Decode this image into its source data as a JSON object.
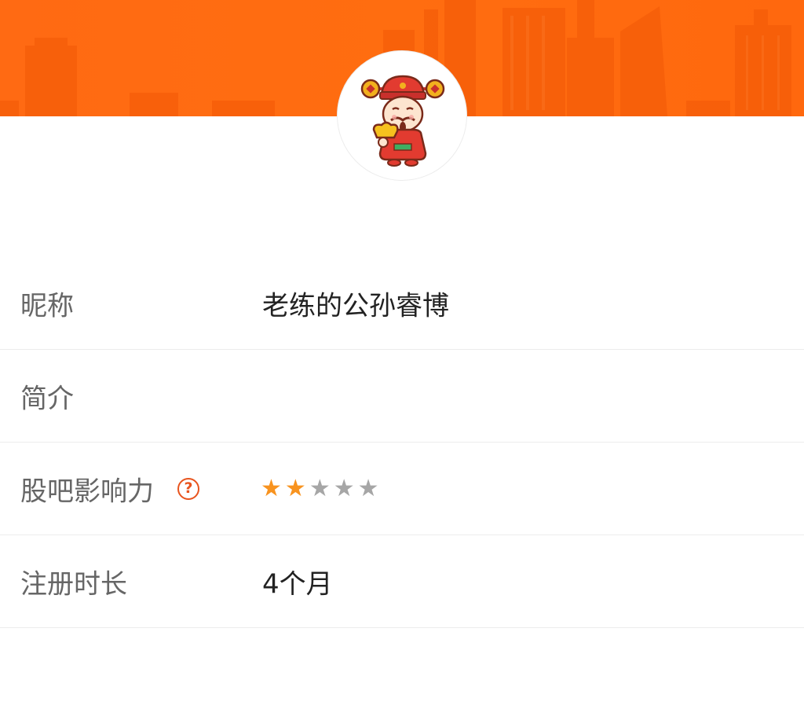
{
  "colors": {
    "banner": "#ff6a13",
    "star_filled": "#f8931f",
    "star_empty": "#a6a6a6",
    "help_icon": "#e8541e"
  },
  "banner": {
    "icon": "city-skyline-background"
  },
  "avatar": {
    "icon": "god-of-wealth-avatar"
  },
  "profile": {
    "nickname": {
      "label": "昵称",
      "value": "老练的公孙睿博"
    },
    "bio": {
      "label": "简介",
      "value": ""
    },
    "influence": {
      "label": "股吧影响力",
      "help_icon": "question-circle-icon",
      "help_glyph": "?",
      "rating": 2,
      "max_rating": 5,
      "star_glyph": "★"
    },
    "registration": {
      "label": "注册时长",
      "value": "4个月"
    }
  }
}
